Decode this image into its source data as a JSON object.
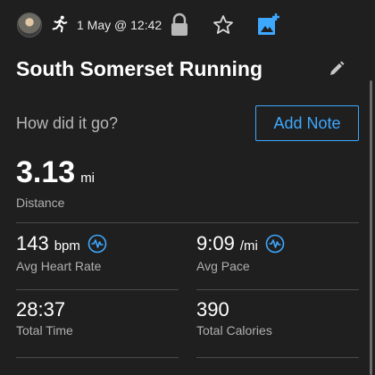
{
  "header": {
    "date_text": "1 May @ 12:42",
    "icons": [
      "avatar",
      "running-icon",
      "lock-icon",
      "star-icon",
      "add-photo-icon"
    ]
  },
  "activity": {
    "title": "South Somerset Running"
  },
  "note": {
    "prompt": "How did it go?",
    "button_label": "Add Note"
  },
  "distance": {
    "value": "3.13",
    "unit": "mi",
    "label": "Distance"
  },
  "stats": {
    "heart_rate": {
      "value": "143",
      "unit": "bpm",
      "label": "Avg Heart Rate"
    },
    "pace": {
      "value": "9:09",
      "unit": "/mi",
      "label": "Avg Pace"
    },
    "time": {
      "value": "28:37",
      "label": "Total Time"
    },
    "calories": {
      "value": "390",
      "label": "Total Calories"
    }
  },
  "colors": {
    "background": "#1f1f1f",
    "accent": "#3ea8ff",
    "text": "#ffffff",
    "muted": "#b0b0b0"
  }
}
